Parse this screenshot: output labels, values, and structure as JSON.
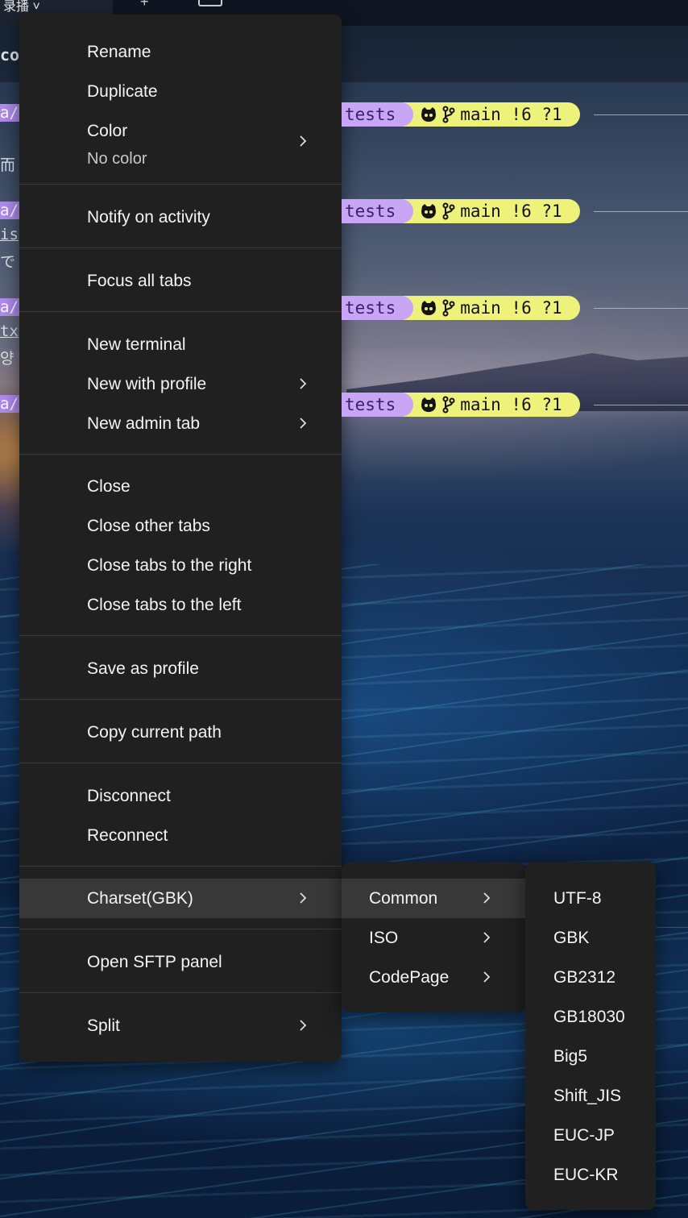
{
  "topbar": {
    "tab_title": "录播 ˅"
  },
  "terminal": {
    "fragments": [
      "col",
      "a/",
      "而",
      "a/",
      "is",
      "で",
      "a/",
      "tx",
      "양",
      "a/"
    ],
    "prompts": [
      {
        "dir": "tests",
        "git": "main !6 ?1"
      },
      {
        "dir": "tests",
        "git": "main !6 ?1"
      },
      {
        "dir": "tests",
        "git": "main !6 ?1"
      },
      {
        "dir": "tests",
        "git": "main !6 ?1"
      }
    ]
  },
  "context_menu": {
    "items": [
      {
        "label": "Rename"
      },
      {
        "label": "Duplicate"
      },
      {
        "label": "Color",
        "sublabel": "No color",
        "has_submenu": true
      },
      {
        "label": "Notify on activity"
      },
      {
        "label": "Focus all tabs"
      },
      {
        "label": "New terminal"
      },
      {
        "label": "New with profile",
        "has_submenu": true
      },
      {
        "label": "New admin tab",
        "has_submenu": true
      },
      {
        "label": "Close"
      },
      {
        "label": "Close other tabs"
      },
      {
        "label": "Close tabs to the right"
      },
      {
        "label": "Close tabs to the left"
      },
      {
        "label": "Save as profile"
      },
      {
        "label": "Copy current path"
      },
      {
        "label": "Disconnect"
      },
      {
        "label": "Reconnect"
      },
      {
        "label": "Charset(GBK)",
        "has_submenu": true,
        "active": true
      },
      {
        "label": "Open SFTP panel"
      },
      {
        "label": "Split",
        "has_submenu": true
      }
    ]
  },
  "charset_submenu": {
    "items": [
      {
        "label": "Common",
        "has_submenu": true,
        "active": true
      },
      {
        "label": "ISO",
        "has_submenu": true
      },
      {
        "label": "CodePage",
        "has_submenu": true
      }
    ]
  },
  "common_submenu": {
    "items": [
      {
        "label": "UTF-8"
      },
      {
        "label": "GBK"
      },
      {
        "label": "GB2312"
      },
      {
        "label": "GB18030"
      },
      {
        "label": "Big5"
      },
      {
        "label": "Shift_JIS"
      },
      {
        "label": "EUC-JP"
      },
      {
        "label": "EUC-KR"
      }
    ]
  },
  "colors": {
    "menu_bg": "#202020",
    "menu_active": "#383838",
    "prompt_dir": "#c8a6f5",
    "prompt_git": "#eef27a"
  }
}
